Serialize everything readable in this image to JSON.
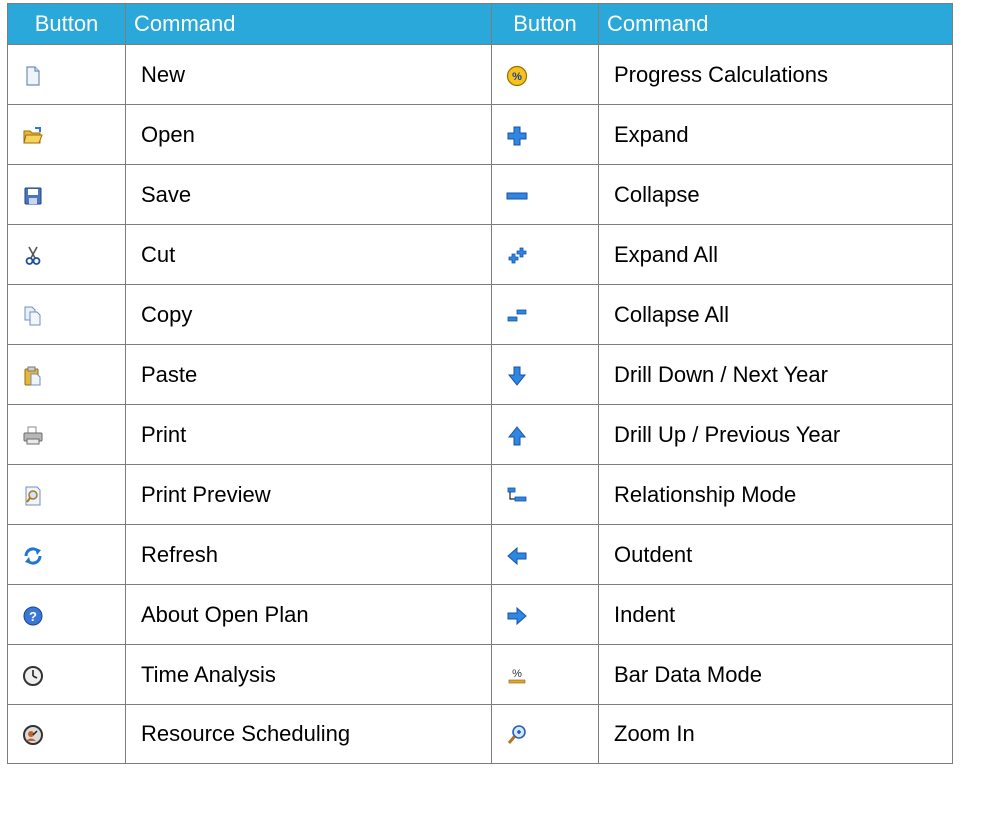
{
  "header": {
    "button_col_1": "Button",
    "command_col_1": "Command",
    "button_col_2": "Button",
    "command_col_2": "Command"
  },
  "rows": [
    {
      "left_icon": "new-document-icon",
      "left_label": "New",
      "right_icon": "progress-calculations-icon",
      "right_label": "Progress Calculations"
    },
    {
      "left_icon": "open-folder-icon",
      "left_label": "Open",
      "right_icon": "expand-plus-icon",
      "right_label": "Expand"
    },
    {
      "left_icon": "save-disk-icon",
      "left_label": "Save",
      "right_icon": "collapse-minus-icon",
      "right_label": "Collapse"
    },
    {
      "left_icon": "cut-scissors-icon",
      "left_label": "Cut",
      "right_icon": "expand-all-icon",
      "right_label": "Expand All"
    },
    {
      "left_icon": "copy-icon",
      "left_label": "Copy",
      "right_icon": "collapse-all-icon",
      "right_label": "Collapse All"
    },
    {
      "left_icon": "paste-clipboard-icon",
      "left_label": "Paste",
      "right_icon": "arrow-down-icon",
      "right_label": "Drill Down / Next Year"
    },
    {
      "left_icon": "printer-icon",
      "left_label": "Print",
      "right_icon": "arrow-up-icon",
      "right_label": "Drill Up / Previous Year"
    },
    {
      "left_icon": "print-preview-icon",
      "left_label": "Print Preview",
      "right_icon": "relationship-mode-icon",
      "right_label": "Relationship Mode"
    },
    {
      "left_icon": "refresh-arrows-icon",
      "left_label": "Refresh",
      "right_icon": "arrow-left-icon",
      "right_label": "Outdent"
    },
    {
      "left_icon": "help-question-icon",
      "left_label": "About Open Plan",
      "right_icon": "arrow-right-icon",
      "right_label": "Indent"
    },
    {
      "left_icon": "time-analysis-clock-icon",
      "left_label": "Time Analysis",
      "right_icon": "bar-data-mode-icon",
      "right_label": "Bar Data Mode"
    },
    {
      "left_icon": "resource-scheduling-icon",
      "left_label": "Resource Scheduling",
      "right_icon": "zoom-in-magnifier-icon",
      "right_label": "Zoom In"
    }
  ],
  "colors": {
    "header_background": "#2aa8d9",
    "header_text": "#ffffff",
    "grid_border": "#7d7d7d",
    "icon_blue": "#1a6fd0"
  }
}
